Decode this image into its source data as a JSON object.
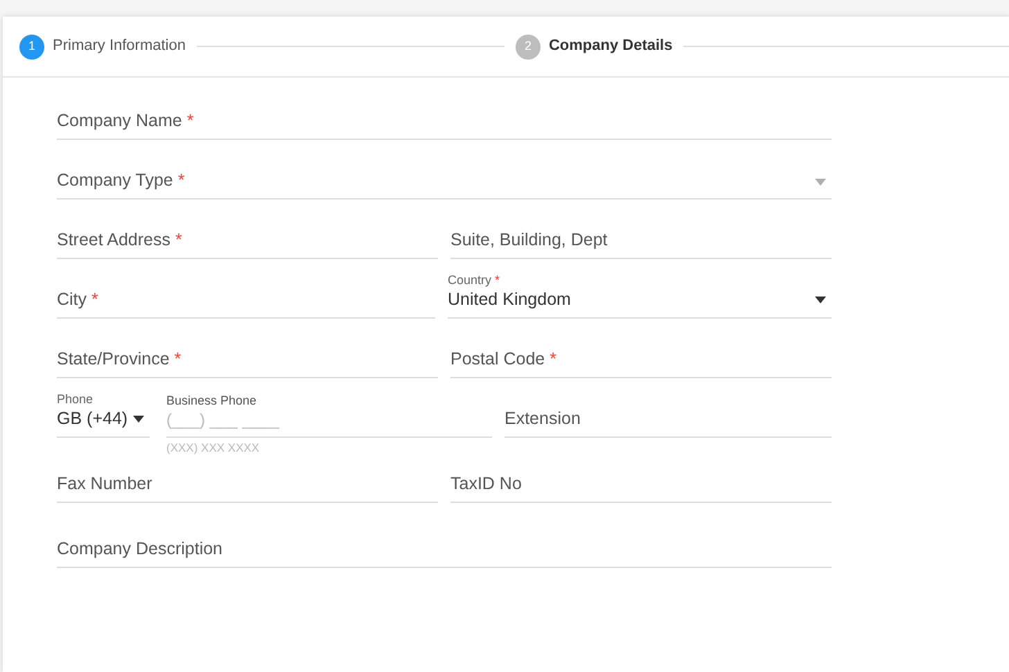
{
  "steps": [
    {
      "number": "1",
      "label": "Primary Information",
      "selected": true
    },
    {
      "number": "2",
      "label": "Company Details",
      "selected": false
    }
  ],
  "rows": [
    [
      {
        "kind": "text",
        "label": "Company Name",
        "mark": "*"
      }
    ],
    [
      {
        "kind": "select",
        "label": "Company Type",
        "mark": "*"
      }
    ],
    [
      {
        "kind": "text",
        "label": "Street Address",
        "mark": "*"
      },
      {
        "kind": "text",
        "label": "Suite, Building, Dept"
      }
    ],
    [
      {
        "kind": "text",
        "label": "City",
        "mark": "*"
      },
      {
        "kind": "floating-select",
        "label": "Country",
        "mark": "*",
        "value": "United Kingdom"
      }
    ],
    [
      {
        "kind": "text",
        "label": "State/Province",
        "mark": "*"
      },
      {
        "kind": "text",
        "label": "Postal Code",
        "mark": "*"
      }
    ],
    [
      {
        "kind": "phone",
        "code_label": "Phone",
        "code_value": "GB (+44)",
        "label": "Business Phone",
        "placeholder": "(___) ___ ____",
        "hint": "(XXX) XXX XXXX",
        "extension": "Extension"
      }
    ],
    [
      {
        "kind": "text",
        "label": "Fax Number"
      },
      {
        "kind": "text",
        "label": "TaxID No"
      }
    ],
    [
      {
        "kind": "text",
        "label": "Company Description"
      }
    ]
  ]
}
